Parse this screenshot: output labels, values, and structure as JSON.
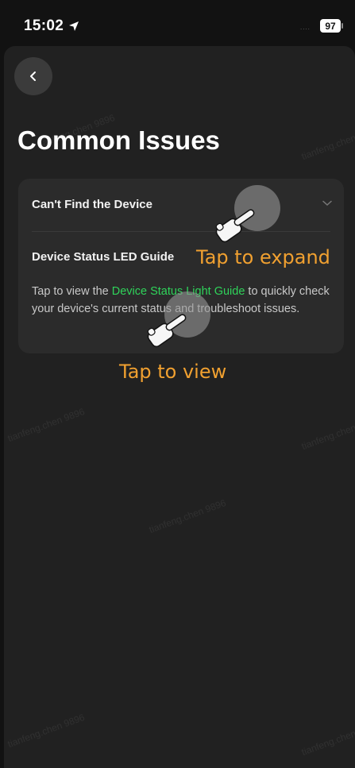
{
  "status_bar": {
    "time": "15:02",
    "signal": "....",
    "battery": "97"
  },
  "page": {
    "title": "Common Issues"
  },
  "faq": {
    "items": [
      {
        "title": "Can't Find the Device",
        "expanded": false
      },
      {
        "title": "Device Status LED Guide",
        "expanded": true,
        "desc_prefix": "Tap to view the ",
        "desc_link": "Device Status Light Guide",
        "desc_suffix": " to quickly check your device's current status and troubleshoot issues."
      }
    ]
  },
  "annotations": {
    "tap_expand": "Tap to expand",
    "tap_view": "Tap to view"
  },
  "watermark": "tianfeng.chen 9896",
  "colors": {
    "link": "#2fd35a",
    "annotation": "#f0a030",
    "background": "#212121",
    "card": "#2b2b2b"
  }
}
